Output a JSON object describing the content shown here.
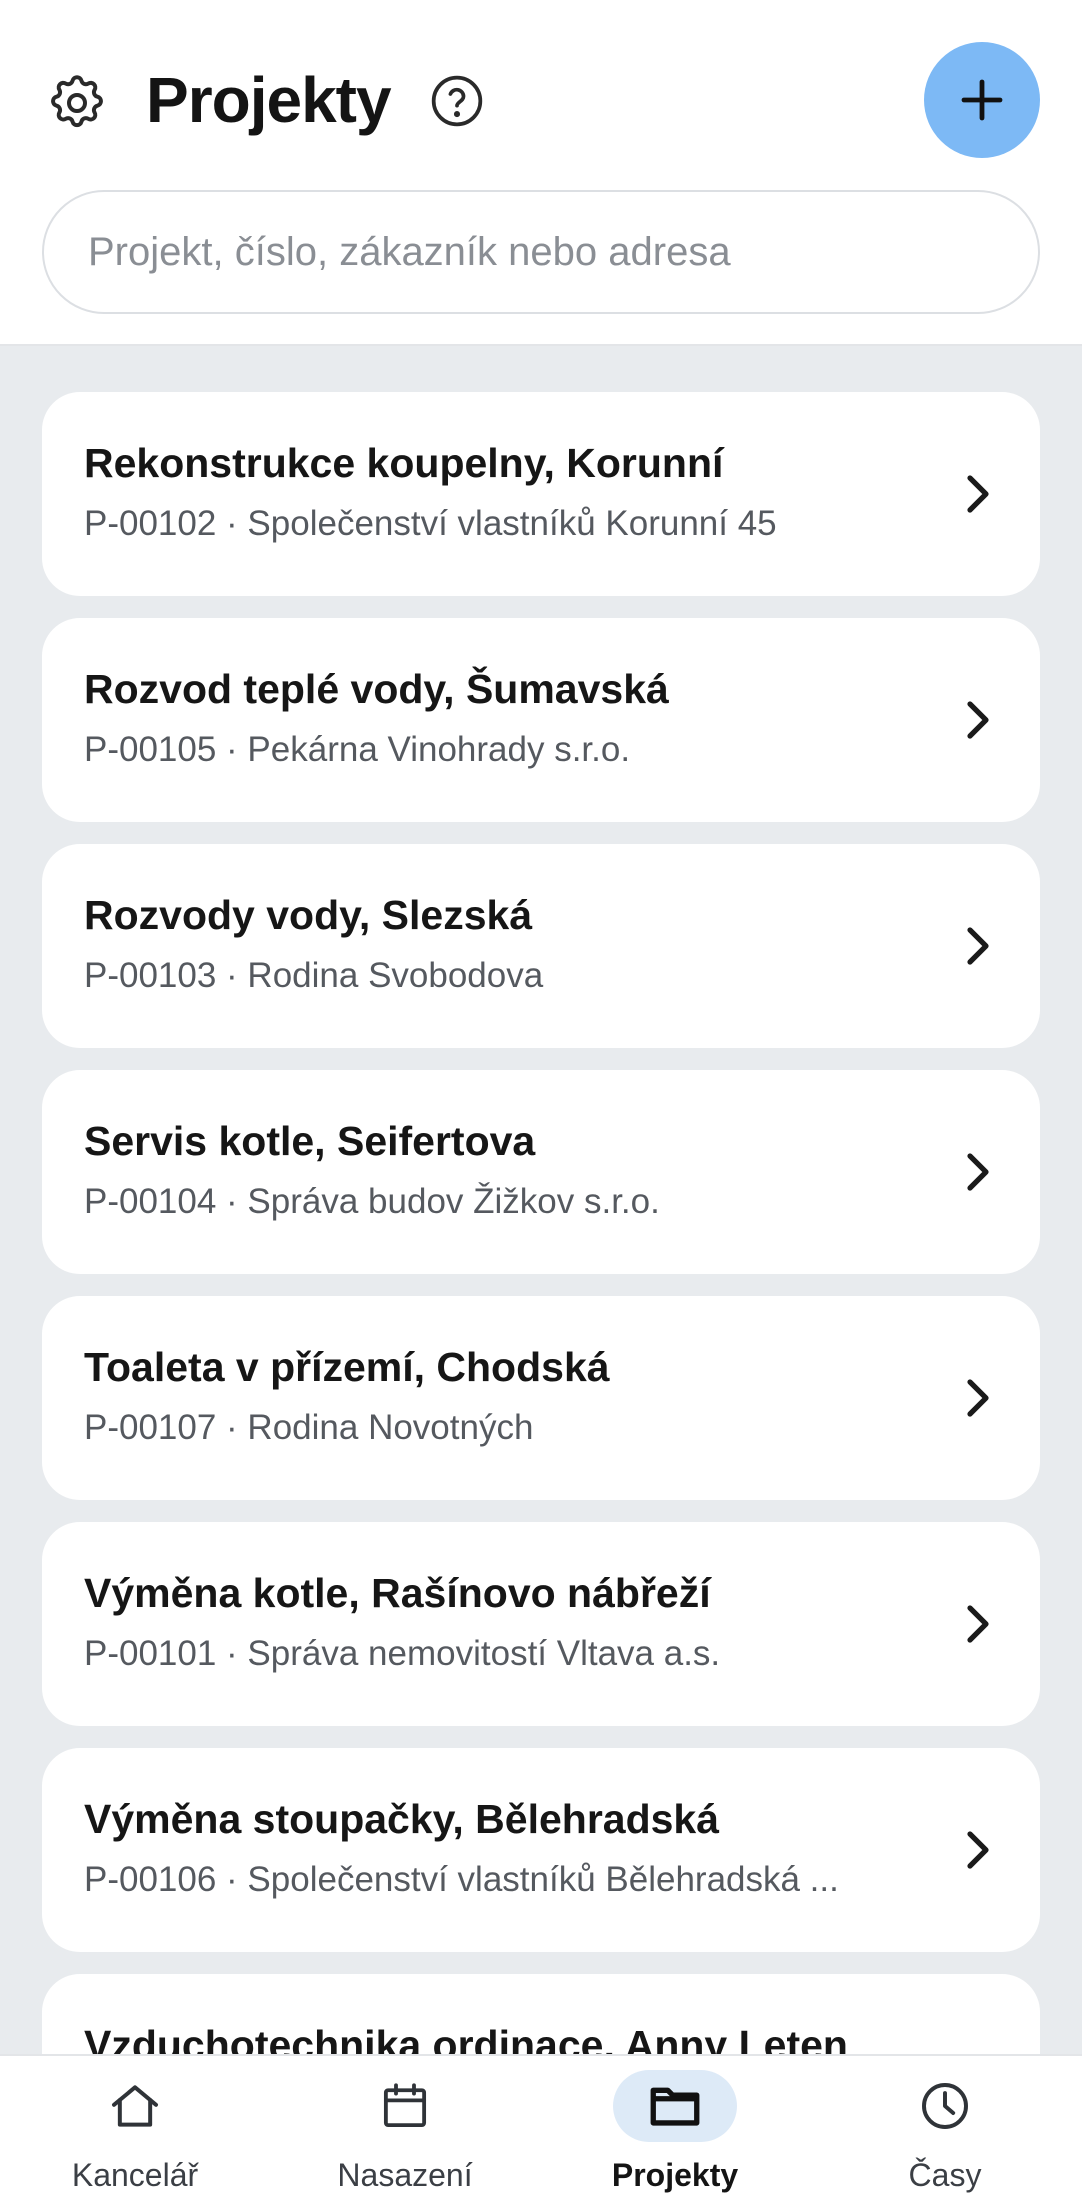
{
  "header": {
    "title": "Projekty",
    "search_placeholder": "Projekt, číslo, zákazník nebo adresa",
    "accent_color": "#7db9f5"
  },
  "projects": [
    {
      "name": "Rekonstrukce koupelny, Korunní",
      "subtitle": "P-00102 · Společenství vlastníků Korunní 45"
    },
    {
      "name": "Rozvod teplé vody, Šumavská",
      "subtitle": "P-00105 · Pekárna Vinohrady s.r.o."
    },
    {
      "name": "Rozvody vody, Slezská",
      "subtitle": "P-00103 · Rodina Svobodova"
    },
    {
      "name": "Servis kotle, Seifertova",
      "subtitle": "P-00104 · Správa budov Žižkov s.r.o."
    },
    {
      "name": "Toaleta v přízemí, Chodská",
      "subtitle": "P-00107 · Rodina Novotných"
    },
    {
      "name": "Výměna kotle, Rašínovo nábřeží",
      "subtitle": "P-00101 · Správa nemovitostí Vltava a.s."
    },
    {
      "name": "Výměna stoupačky, Bělehradská",
      "subtitle": "P-00106 · Společenství vlastníků Bělehradská ..."
    },
    {
      "name": "Vzduchotechnika ordinace, Anny Leten",
      "subtitle": ""
    }
  ],
  "nav": {
    "items": [
      {
        "label": "Kancelář",
        "icon": "home-icon"
      },
      {
        "label": "Nasazení",
        "icon": "calendar-icon"
      },
      {
        "label": "Projekty",
        "icon": "folder-icon",
        "active": true
      },
      {
        "label": "Časy",
        "icon": "clock-icon"
      }
    ]
  }
}
